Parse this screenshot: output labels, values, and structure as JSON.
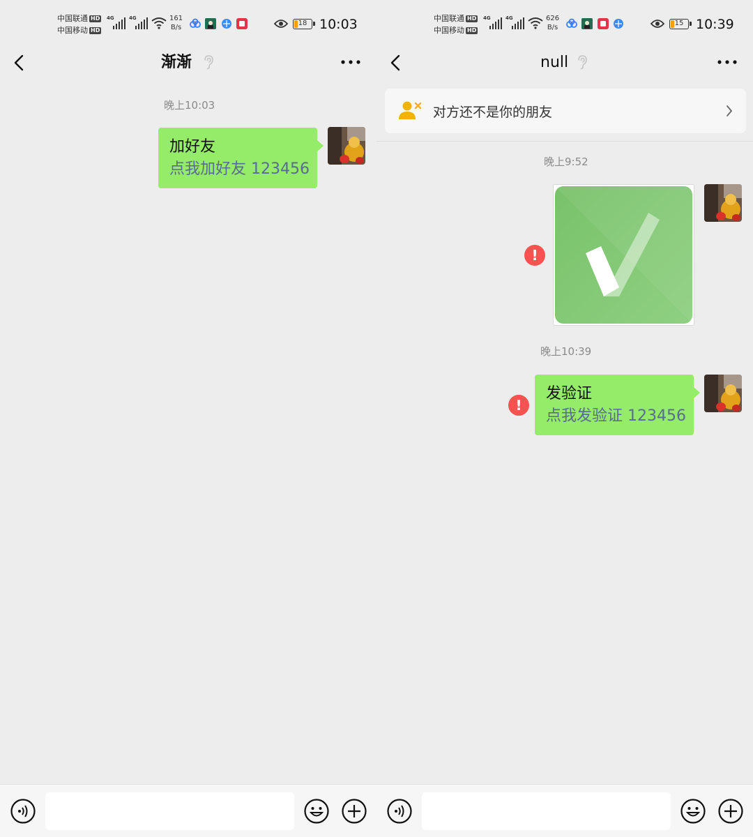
{
  "screens": [
    {
      "status": {
        "carrier_1": "中国联通",
        "carrier_2": "中国移动",
        "hd_1": "HD",
        "hd_2": "HD",
        "net_1": "4G",
        "net_2": "4G",
        "speed_value": "161",
        "speed_unit": "B/s",
        "battery": "18",
        "time": "10:03"
      },
      "nav": {
        "title": "渐渐",
        "back_icon": "chevron-left-icon",
        "more_icon": "more-dots-icon"
      },
      "timestamp_1": "晚上10:03",
      "message_1": {
        "line1": "加好友",
        "line2": "点我加好友 123456"
      },
      "input_bar": {
        "voice_icon": "voice-icon",
        "emoji_icon": "emoji-icon",
        "plus_icon": "plus-icon"
      }
    },
    {
      "status": {
        "carrier_1": "中国联通",
        "carrier_2": "中国移动",
        "hd_1": "HD",
        "hd_2": "HD",
        "net_1": "4G",
        "net_2": "4G",
        "speed_value": "626",
        "speed_unit": "B/s",
        "battery": "15",
        "time": "10:39"
      },
      "nav": {
        "title": "null",
        "back_icon": "chevron-left-icon",
        "more_icon": "more-dots-icon"
      },
      "banner": {
        "text": "对方还不是你的朋友",
        "icon": "user-remove-icon"
      },
      "timestamp_1": "晚上9:52",
      "timestamp_2": "晚上10:39",
      "image_message": {
        "icon": "check-mark-image"
      },
      "failed_marker": "!",
      "message_2": {
        "line1": "发验证",
        "line2": "点我发验证 123456"
      },
      "input_bar": {
        "voice_icon": "voice-icon",
        "emoji_icon": "emoji-icon",
        "plus_icon": "plus-icon"
      }
    }
  ],
  "colors": {
    "bubble": "#95ec69",
    "link": "#576b95",
    "error": "#fa5151",
    "background": "#ededed"
  }
}
